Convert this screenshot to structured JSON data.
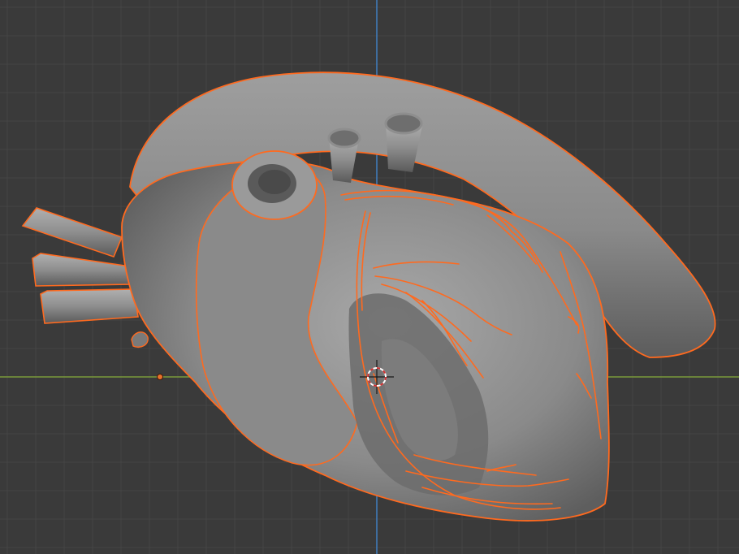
{
  "viewport": {
    "background": "#3a3a3a",
    "grid_minor": "#444444",
    "grid_major": "#4a4a4a"
  },
  "axes": {
    "x_axis_color": "#7a9a3a",
    "y_axis_color": "#3f7ec0"
  },
  "model": {
    "mesh_color": "#8c8c8c",
    "mesh_shadow": "#6a6a6a",
    "mesh_highlight": "#a6a6a6",
    "selection_outline": "#ff6a1f",
    "origin_color": "#e8702a"
  },
  "cursor": {
    "ring_color": "#ffffff",
    "dash_color": "#d03030",
    "crosshair_color": "#1a1a1a"
  }
}
